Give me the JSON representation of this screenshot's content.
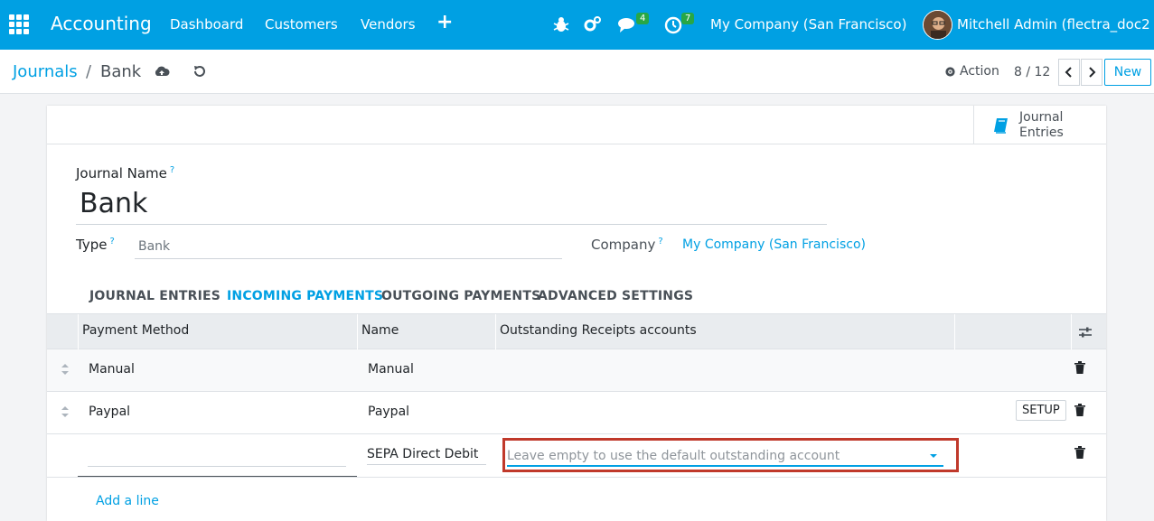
{
  "navbar": {
    "app_name": "Accounting",
    "menu": [
      "Dashboard",
      "Customers",
      "Vendors"
    ],
    "messages_count": "4",
    "activities_count": "7",
    "company": "My Company (San Francisco)",
    "user": "Mitchell Admin (flectra_doc2"
  },
  "breadcrumb": {
    "parent": "Journals",
    "separator": "/",
    "current": "Bank"
  },
  "control": {
    "action_label": "Action",
    "pager": "8 / 12",
    "new_label": "New"
  },
  "smart_button": {
    "label": "Journal Entries"
  },
  "form": {
    "journal_name_label": "Journal Name",
    "journal_name_value": "Bank",
    "type_label": "Type",
    "type_value": "Bank",
    "company_label": "Company",
    "company_value": "My Company (San Francisco)",
    "help_mark": "?"
  },
  "tabs": [
    {
      "label": "JOURNAL ENTRIES",
      "active": false
    },
    {
      "label": "INCOMING PAYMENTS",
      "active": true
    },
    {
      "label": "OUTGOING PAYMENTS",
      "active": false
    },
    {
      "label": "ADVANCED SETTINGS",
      "active": false
    }
  ],
  "table": {
    "headers": [
      "Payment Method",
      "Name",
      "Outstanding Receipts accounts"
    ],
    "rows": [
      {
        "method": "Manual",
        "name": "Manual"
      },
      {
        "method": "Paypal",
        "name": "Paypal",
        "button": "SETUP"
      }
    ],
    "edit_row": {
      "method": "",
      "name": "SEPA Direct Debit",
      "account_placeholder": "Leave empty to use the default outstanding account"
    },
    "add_line": "Add a line"
  },
  "colors": {
    "brand": "#00a0e3",
    "highlight": "#c0392b",
    "badge": "#28a745"
  }
}
